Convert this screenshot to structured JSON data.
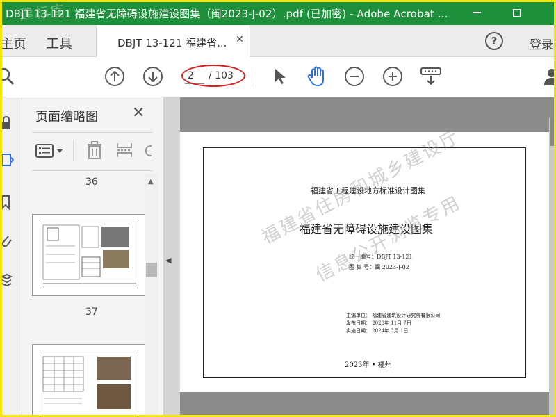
{
  "window": {
    "title": "DBJT 13-121 福建省无障碍设施建设图集（闽2023-J-02）.pdf (已加密) - Adobe Acrobat ...",
    "watermark": "建标库"
  },
  "tabs": {
    "home": "主页",
    "tools": "工具",
    "document": "DBJT 13-121 福建省...",
    "login": "登录"
  },
  "toolbar": {
    "current_page": "2",
    "total_pages": "/ 103"
  },
  "thumbnails": {
    "panel_title": "页面缩略图",
    "page_numbers": [
      "36",
      "37"
    ]
  },
  "document": {
    "series": "福建省工程建设地方标准设计图集",
    "title": "福建省无障碍设施建设图集",
    "id_line": "统一编号：DBJT 13-121",
    "atlas_line": "图 集 号：闽 2023-J-02",
    "unit_line": "主编单位：  福建省建筑设计研究院有限公司",
    "issue_line": "发布日期：  2023年 11月 7日",
    "impl_line": "实施日期：  2024年  3月 1日",
    "footer": "2023年 • 福州",
    "watermark_1": "福建省住房和城乡建设厅",
    "watermark_2": "信息公开浏览专用"
  },
  "colors": {
    "titlebar": "#1e8f3a",
    "frame": "#f2e500",
    "highlight_oval": "#d42020",
    "hand_tool": "#2f6fdb"
  }
}
